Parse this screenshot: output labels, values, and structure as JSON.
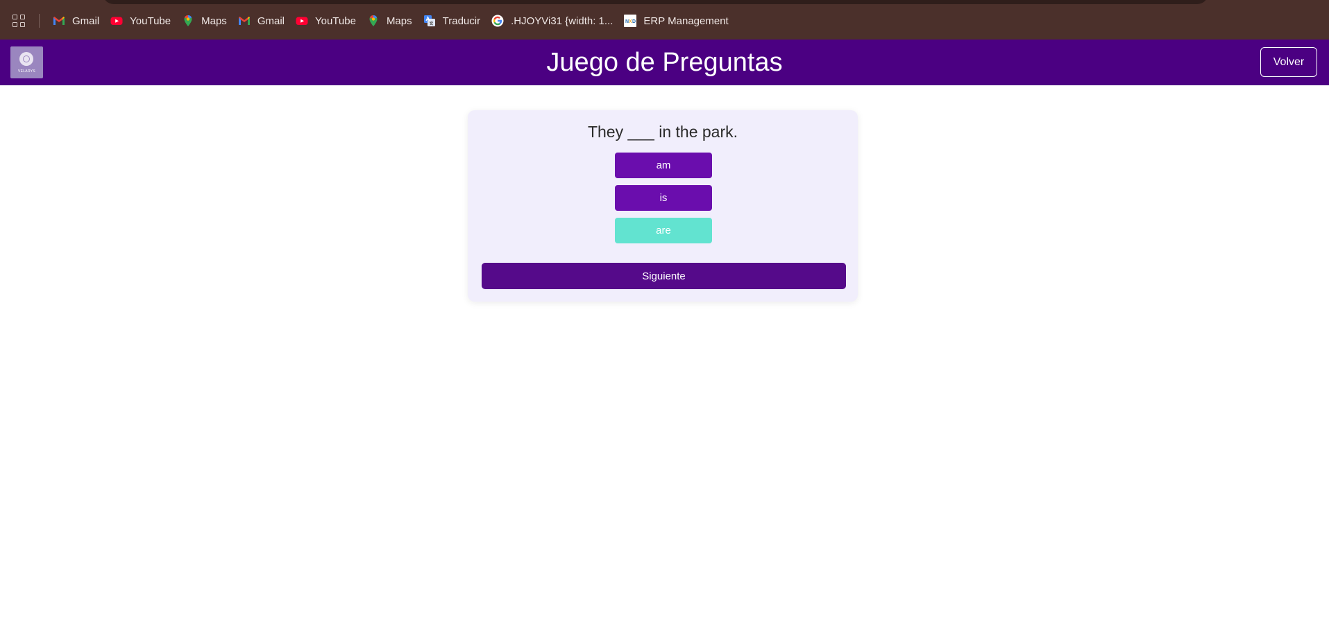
{
  "bookmarks": [
    {
      "label": "Gmail",
      "icon": "gmail-icon"
    },
    {
      "label": "YouTube",
      "icon": "youtube-icon"
    },
    {
      "label": "Maps",
      "icon": "maps-icon"
    },
    {
      "label": "Gmail",
      "icon": "gmail-icon"
    },
    {
      "label": "YouTube",
      "icon": "youtube-icon"
    },
    {
      "label": "Maps",
      "icon": "maps-icon"
    },
    {
      "label": "Traducir",
      "icon": "translate-icon"
    },
    {
      "label": ".HJOYVi31 {width: 1...",
      "icon": "google-icon"
    },
    {
      "label": "ERP Management",
      "icon": "erp-icon"
    }
  ],
  "header": {
    "title": "Juego de Preguntas",
    "back_label": "Volver",
    "logo_text": "VELARYS"
  },
  "quiz": {
    "question": "They ___ in the park.",
    "options": [
      {
        "label": "am",
        "state": "default"
      },
      {
        "label": "is",
        "state": "default"
      },
      {
        "label": "are",
        "state": "correct"
      }
    ],
    "next_label": "Siguiente"
  },
  "colors": {
    "bookmarks_bar": "#4b302b",
    "header": "#4b0082",
    "option": "#6a0dad",
    "option_correct": "#62e3d0",
    "next_button": "#550a8a",
    "card": "#f1eefc"
  }
}
